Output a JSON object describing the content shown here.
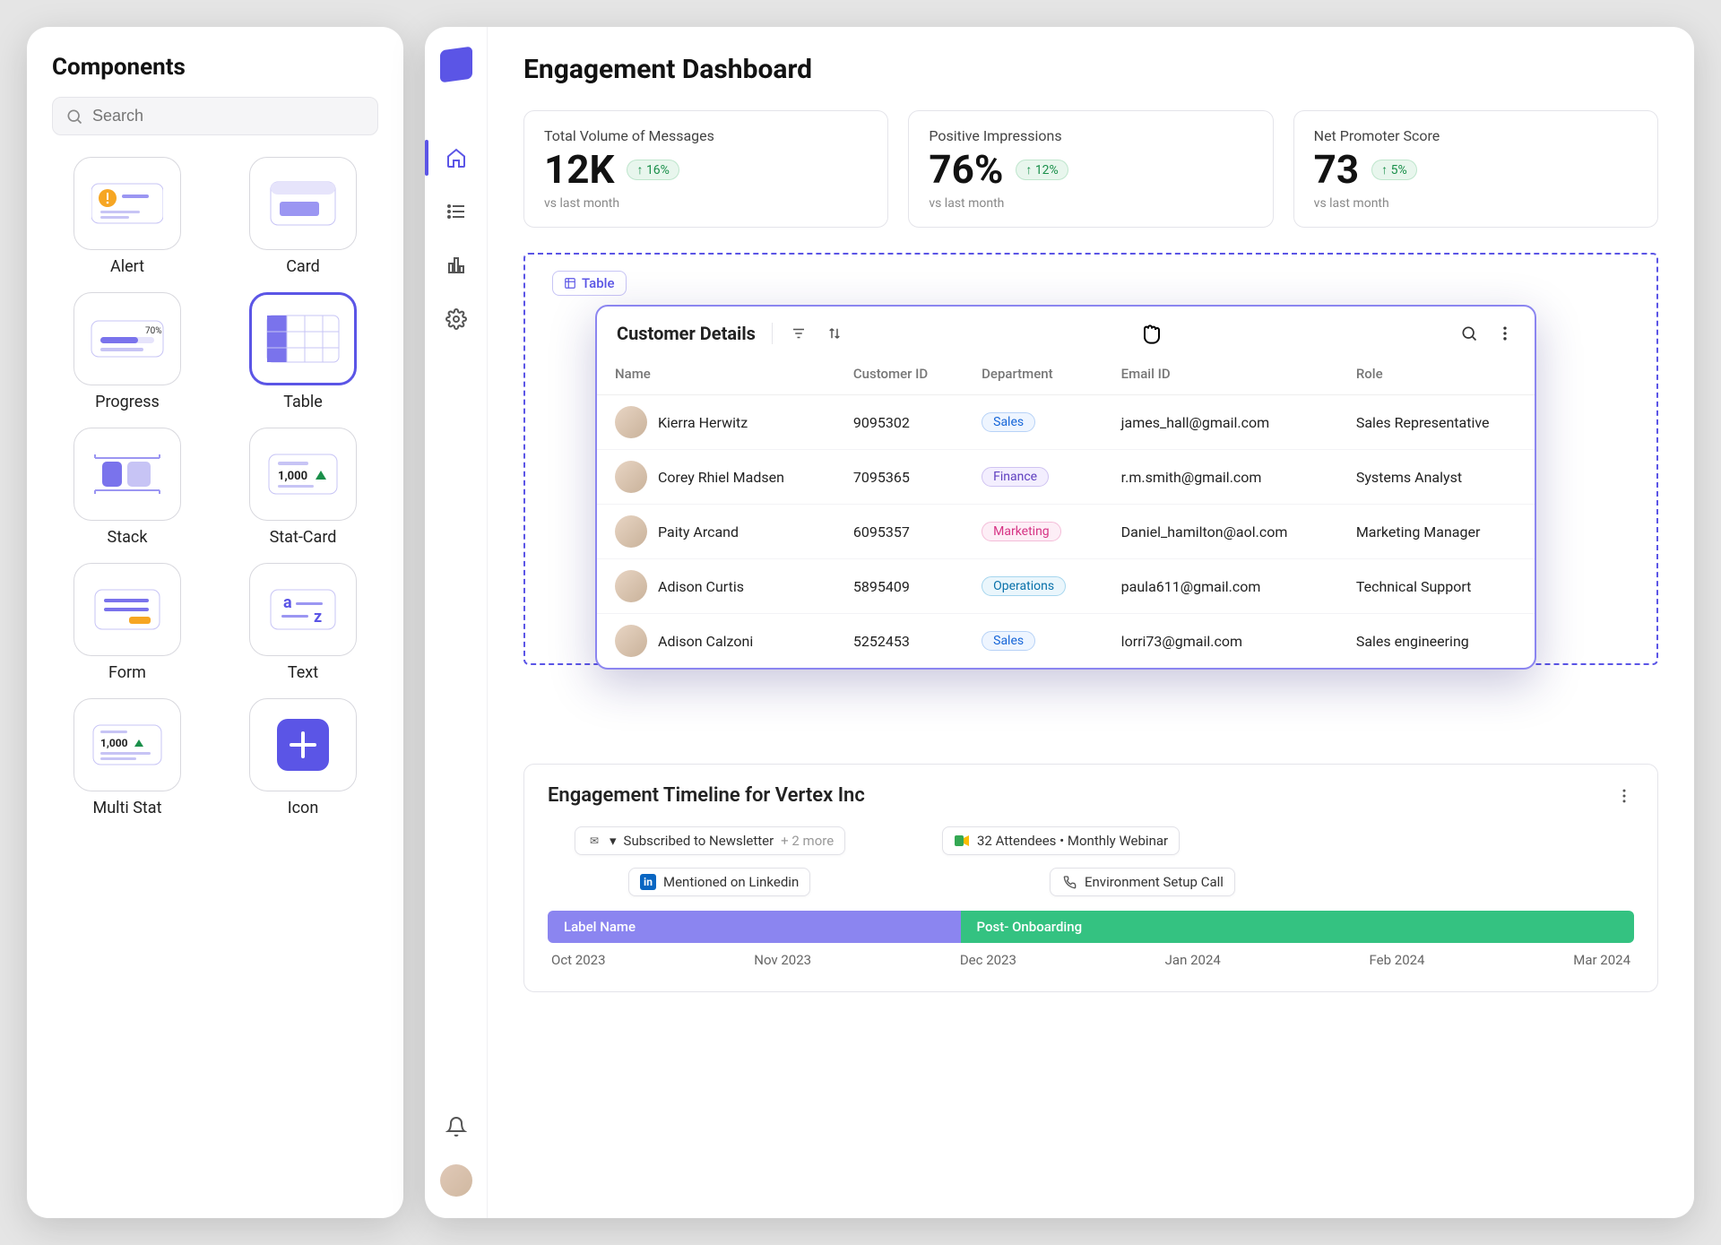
{
  "components": {
    "title": "Components",
    "search_placeholder": "Search",
    "items": [
      {
        "label": "Alert"
      },
      {
        "label": "Card"
      },
      {
        "label": "Progress"
      },
      {
        "label": "Table",
        "selected": true
      },
      {
        "label": "Stack"
      },
      {
        "label": "Stat-Card"
      },
      {
        "label": "Form"
      },
      {
        "label": "Text"
      },
      {
        "label": "Multi Stat"
      },
      {
        "label": "Icon"
      }
    ],
    "stat_thumb_value": "1,000",
    "progress_thumb_value": "70%"
  },
  "dashboard": {
    "title": "Engagement Dashboard",
    "nav": {
      "home": "home-icon",
      "list": "list-icon",
      "chart": "bar-chart-icon",
      "settings": "gear-icon",
      "bell": "bell-icon"
    },
    "stats": [
      {
        "title": "Total Volume of Messages",
        "value": "12K",
        "delta": "↑ 16%",
        "sub": "vs last month"
      },
      {
        "title": "Positive Impressions",
        "value": "76%",
        "delta": "↑ 12%",
        "sub": "vs last month"
      },
      {
        "title": "Net Promoter Score",
        "value": "73",
        "delta": "↑ 5%",
        "sub": "vs last month"
      }
    ],
    "drop_label": "Table",
    "table": {
      "title": "Customer Details",
      "columns": [
        "Name",
        "Customer ID",
        "Department",
        "Email ID",
        "Role"
      ],
      "rows": [
        {
          "name": "Kierra Herwitz",
          "id": "9095302",
          "dept": "Sales",
          "dept_class": "d-sales",
          "email": "james_hall@gmail.com",
          "role": "Sales Representative"
        },
        {
          "name": "Corey Rhiel Madsen",
          "id": "7095365",
          "dept": "Finance",
          "dept_class": "d-finance",
          "email": "r.m.smith@gmail.com",
          "role": "Systems Analyst"
        },
        {
          "name": "Paity Arcand",
          "id": "6095357",
          "dept": "Marketing",
          "dept_class": "d-marketing",
          "email": "Daniel_hamilton@aol.com",
          "role": "Marketing Manager"
        },
        {
          "name": "Adison Curtis",
          "id": "5895409",
          "dept": "Operations",
          "dept_class": "d-ops",
          "email": "paula611@gmail.com",
          "role": "Technical Support"
        },
        {
          "name": "Adison Calzoni",
          "id": "5252453",
          "dept": "Sales",
          "dept_class": "d-sales",
          "email": "lorri73@gmail.com",
          "role": "Sales engineering"
        }
      ]
    },
    "timeline": {
      "title": "Engagement Timeline for Vertex Inc",
      "events_top": [
        {
          "icon": "mail",
          "label_prefix": "▾ ",
          "label": "Subscribed to Newsletter",
          "suffix": "+ 2 more"
        },
        {
          "icon": "meet",
          "label": "32 Attendees • Monthly Webinar"
        }
      ],
      "events_bottom": [
        {
          "icon": "linkedin",
          "label": "Mentioned on Linkedin"
        },
        {
          "icon": "phone",
          "label": "Environment Setup Call"
        }
      ],
      "segments": [
        {
          "label": "Label Name"
        },
        {
          "label": "Post- Onboarding"
        }
      ],
      "axis": [
        "Oct 2023",
        "Nov 2023",
        "Dec 2023",
        "Jan 2024",
        "Feb 2024",
        "Mar 2024"
      ]
    }
  }
}
